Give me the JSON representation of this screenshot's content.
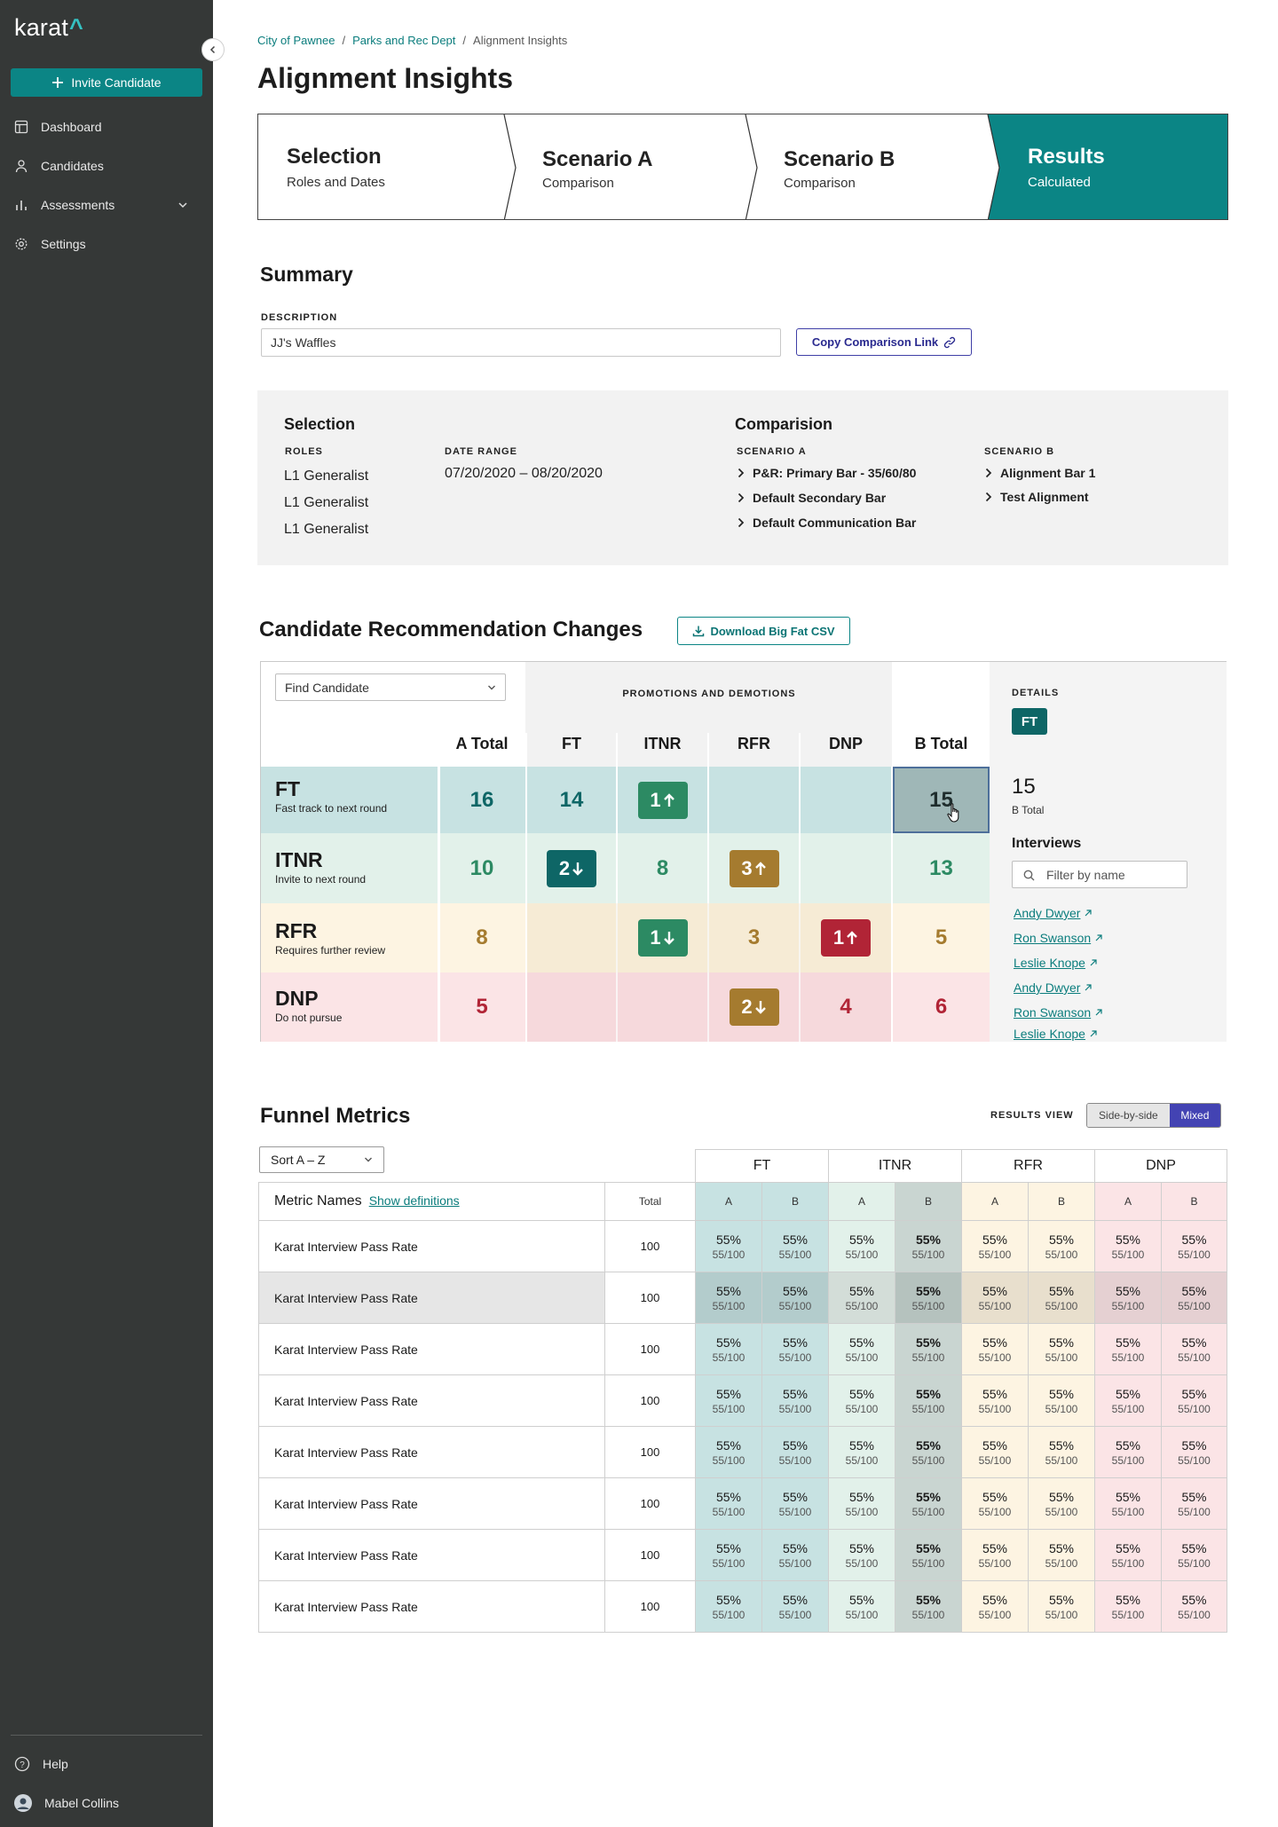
{
  "app": {
    "logo": "karat",
    "logo_mark": "^"
  },
  "sidebar": {
    "invite_label": "Invite Candidate",
    "items": [
      {
        "label": "Dashboard",
        "icon": "dashboard-icon"
      },
      {
        "label": "Candidates",
        "icon": "person-icon"
      },
      {
        "label": "Assessments",
        "icon": "bar-chart-icon"
      },
      {
        "label": "Settings",
        "icon": "gear-icon"
      }
    ],
    "help": "Help",
    "user": "Mabel Collins"
  },
  "breadcrumb": [
    "City of Pawnee",
    "Parks and Rec Dept",
    "Alignment Insights"
  ],
  "page_title": "Alignment Insights",
  "steps": [
    {
      "title": "Selection",
      "subtitle": "Roles and Dates"
    },
    {
      "title": "Scenario A",
      "subtitle": "Comparison"
    },
    {
      "title": "Scenario B",
      "subtitle": "Comparison"
    },
    {
      "title": "Results",
      "subtitle": "Calculated"
    }
  ],
  "summary": {
    "title": "Summary",
    "description_label": "DESCRIPTION",
    "description_value": "JJ's Waffles",
    "copy_link_label": "Copy Comparison Link"
  },
  "selection": {
    "title": "Selection",
    "roles_label": "ROLES",
    "roles": [
      "L1 Generalist",
      "L1 Generalist",
      "L1 Generalist"
    ],
    "date_label": "DATE RANGE",
    "date_range": "07/20/2020 – 08/20/2020",
    "comparison_title": "Comparision",
    "scenario_a_label": "SCENARIO A",
    "scenario_a": [
      "P&R: Primary Bar - 35/60/80",
      "Default Secondary Bar",
      "Default Communication Bar"
    ],
    "scenario_b_label": "SCENARIO B",
    "scenario_b": [
      "Alignment Bar 1",
      "Test Alignment"
    ]
  },
  "crc": {
    "title": "Candidate Recommendation Changes",
    "download_label": "Download Big Fat CSV",
    "find_placeholder": "Find Candidate",
    "promo_label": "PROMOTIONS AND DEMOTIONS",
    "a_total_label": "A Total",
    "b_total_label": "B Total",
    "columns": [
      "FT",
      "ITNR",
      "RFR",
      "DNP"
    ],
    "rows": [
      {
        "code": "FT",
        "desc": "Fast track to next round",
        "a_total": "16",
        "cells": [
          {
            "v": "14"
          },
          {
            "v": "1",
            "badge": "up"
          },
          {
            "v": ""
          },
          {
            "v": ""
          }
        ],
        "b_total": "15"
      },
      {
        "code": "ITNR",
        "desc": "Invite to next round",
        "a_total": "10",
        "cells": [
          {
            "v": "2",
            "badge": "down"
          },
          {
            "v": "8"
          },
          {
            "v": "3",
            "badge": "up"
          },
          {
            "v": ""
          }
        ],
        "b_total": "13"
      },
      {
        "code": "RFR",
        "desc": "Requires further review",
        "a_total": "8",
        "cells": [
          {
            "v": ""
          },
          {
            "v": "1",
            "badge": "down"
          },
          {
            "v": "3"
          },
          {
            "v": "1",
            "badge": "up"
          }
        ],
        "b_total": "5"
      },
      {
        "code": "DNP",
        "desc": "Do not pursue",
        "a_total": "5",
        "cells": [
          {
            "v": ""
          },
          {
            "v": ""
          },
          {
            "v": "2",
            "badge": "down"
          },
          {
            "v": "4"
          }
        ],
        "b_total": "6"
      }
    ],
    "details": {
      "label": "DETAILS",
      "chip": "FT",
      "value": "15",
      "value_label": "B Total",
      "interviews_label": "Interviews",
      "filter_placeholder": "Filter by name",
      "people": [
        "Andy Dwyer",
        "Ron Swanson",
        "Leslie Knope",
        "Andy Dwyer",
        "Ron Swanson",
        "Leslie Knope"
      ]
    }
  },
  "funnel": {
    "title": "Funnel Metrics",
    "results_view_label": "RESULTS VIEW",
    "view_options": [
      "Side-by-side",
      "Mixed"
    ],
    "sort_label": "Sort A – Z",
    "metric_names_label": "Metric Names",
    "show_definitions": "Show definitions",
    "total_label": "Total",
    "groups": [
      "FT",
      "ITNR",
      "RFR",
      "DNP"
    ],
    "sub_cols": [
      "A",
      "B"
    ],
    "rows": [
      {
        "name": "Karat Interview Pass Rate",
        "total": "100",
        "pct": "55%",
        "frac": "55/100"
      },
      {
        "name": "Karat Interview Pass Rate",
        "total": "100",
        "pct": "55%",
        "frac": "55/100"
      },
      {
        "name": "Karat Interview Pass Rate",
        "total": "100",
        "pct": "55%",
        "frac": "55/100"
      },
      {
        "name": "Karat Interview Pass Rate",
        "total": "100",
        "pct": "55%",
        "frac": "55/100"
      },
      {
        "name": "Karat Interview Pass Rate",
        "total": "100",
        "pct": "55%",
        "frac": "55/100"
      },
      {
        "name": "Karat Interview Pass Rate",
        "total": "100",
        "pct": "55%",
        "frac": "55/100"
      },
      {
        "name": "Karat Interview Pass Rate",
        "total": "100",
        "pct": "55%",
        "frac": "55/100"
      },
      {
        "name": "Karat Interview Pass Rate",
        "total": "100",
        "pct": "55%",
        "frac": "55/100"
      }
    ]
  },
  "colors": {
    "teal": "#0b8585",
    "ft_bg": "#c7e2e2",
    "itnr_bg": "#e2f1ea",
    "rfr_bg": "#fdf4e2",
    "dnp_bg": "#fbe4e6",
    "up_green": "#2c8a63",
    "down_teal": "#0e6666",
    "rfr_gold": "#a57b2f",
    "dnp_red": "#b12436"
  }
}
